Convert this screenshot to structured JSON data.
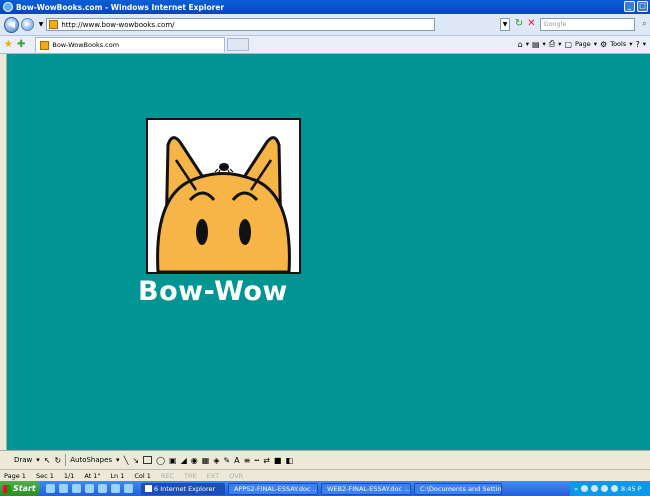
{
  "window": {
    "title": "Bow-WowBooks.com - Windows Internet Explorer"
  },
  "address": {
    "url": "http://www.bow-wowbooks.com/"
  },
  "search": {
    "placeholder": "Google"
  },
  "tab": {
    "label": "Bow-WowBooks.com"
  },
  "commands": {
    "page_label": "Page",
    "tools_label": "Tools"
  },
  "page": {
    "brand": "Bow-Wow",
    "background": "#009593",
    "dog_color": "#f7b548"
  },
  "drawing": {
    "draw_label": "Draw",
    "autoshapes_label": "AutoShapes"
  },
  "status": {
    "page": "Page 1",
    "sec": "Sec 1",
    "count": "1/1",
    "at": "At 1\"",
    "ln": "Ln 1",
    "col": "Col 1",
    "rec": "REC",
    "trk": "TRK",
    "ext": "EXT",
    "ovr": "OVR"
  },
  "taskbar": {
    "start": "Start",
    "tasks": [
      "6 Internet Explorer",
      "APPS2-FINAL-ESSAY.doc ...",
      "WEB2-FINAL-ESSAY.doc ...",
      "C:\\Documents and Settin..."
    ],
    "clock": "8:45 P"
  }
}
